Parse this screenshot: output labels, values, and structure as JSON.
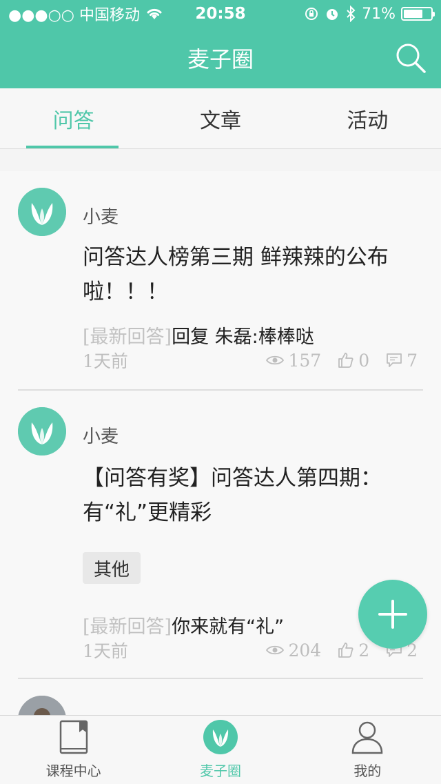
{
  "status_bar": {
    "carrier": "●●●○○ 中国移动",
    "time": "20:58",
    "battery": "71%",
    "battery_level": 0.71
  },
  "header": {
    "title": "麦子圈"
  },
  "tabs": [
    {
      "label": "问答",
      "active": true
    },
    {
      "label": "文章",
      "active": false
    },
    {
      "label": "活动",
      "active": false
    }
  ],
  "posts": [
    {
      "author": "小麦",
      "title": "问答达人榜第三期 鲜辣辣的公布啦！！！",
      "latest_prefix": "[最新回答]",
      "latest_text": "回复 朱磊:棒棒哒",
      "time": "1天前",
      "views": "157",
      "likes": "0",
      "comments": "7"
    },
    {
      "author": "小麦",
      "title": "【问答有奖】问答达人第四期： 有“礼”更精彩",
      "tag": "其他",
      "latest_prefix": "[最新回答]",
      "latest_text": "你来就有“礼”",
      "time": "1天前",
      "views": "204",
      "likes": "2",
      "comments": "2"
    }
  ],
  "tabbar": [
    {
      "label": "课程中心",
      "icon": "book-icon",
      "active": false
    },
    {
      "label": "麦子圈",
      "icon": "wheat-leaf-icon",
      "active": true
    },
    {
      "label": "我的",
      "icon": "user-icon",
      "active": false
    }
  ],
  "colors": {
    "accent": "#4fc7a9",
    "fab": "#56cdb0"
  }
}
